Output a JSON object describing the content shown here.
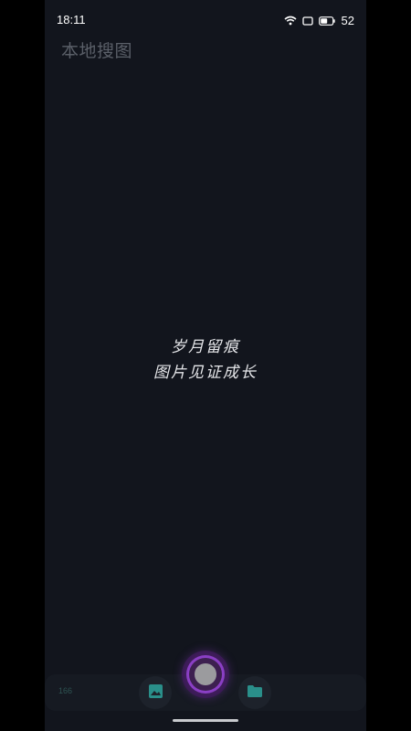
{
  "status_bar": {
    "time": "18:11",
    "battery_level": "52",
    "icons": [
      "wifi-icon",
      "sim-icon",
      "battery-icon"
    ]
  },
  "app": {
    "title": "本地搜图"
  },
  "main": {
    "slogan_line1": "岁月留痕",
    "slogan_line2": "图片见证成长"
  },
  "bottom_nav": {
    "left_label": "166",
    "buttons": [
      {
        "icon": "image-icon",
        "accent": "#2a8f8a"
      },
      {
        "icon": "record-button-icon",
        "accent": "#8a3fc4"
      },
      {
        "icon": "folder-icon",
        "accent": "#2a8f8a"
      }
    ]
  },
  "colors": {
    "background": "#12151d",
    "teal_accent": "#2a8f8a",
    "purple_accent": "#8a3fc4"
  }
}
